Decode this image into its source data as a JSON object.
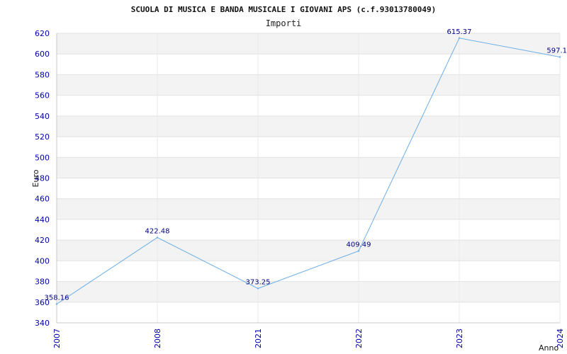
{
  "chart_data": {
    "type": "line",
    "title": "SCUOLA DI MUSICA E BANDA MUSICALE I GIOVANI APS (c.f.93013780049)",
    "subtitle": "Importi",
    "xlabel": "Anno",
    "ylabel": "Euro",
    "categories": [
      "2007",
      "2008",
      "2021",
      "2022",
      "2023",
      "2024"
    ],
    "values": [
      358.16,
      422.48,
      373.25,
      409.49,
      615.37,
      597.1
    ],
    "data_labels": [
      "358.16",
      "422.48",
      "373.25",
      "409.49",
      "615.37",
      "597.1"
    ],
    "ylim": [
      340,
      620
    ],
    "yticks": [
      340,
      360,
      380,
      400,
      420,
      440,
      460,
      480,
      500,
      520,
      540,
      560,
      580,
      600,
      620
    ],
    "grid": true,
    "line_color": "#6aaee8",
    "band_color": "#f3f3f3",
    "tick_color": "#0000aa"
  }
}
